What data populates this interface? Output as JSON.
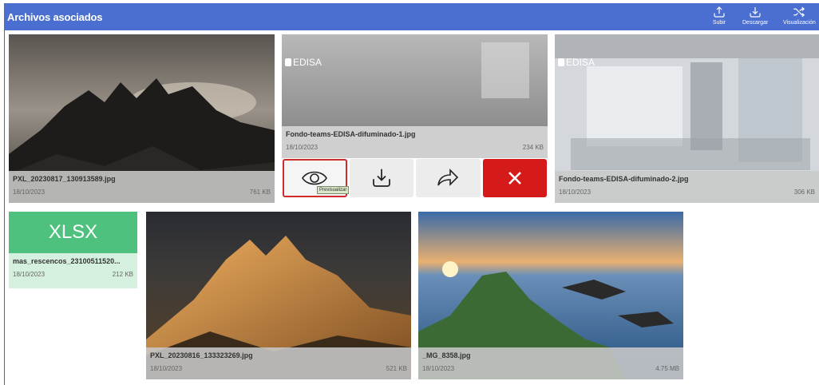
{
  "header": {
    "title": "Archivos asociados",
    "buttons": [
      {
        "label": "Subir",
        "icon": "upload-icon"
      },
      {
        "label": "Descargar",
        "icon": "download-icon"
      },
      {
        "label": "Visualización",
        "icon": "shuffle-icon"
      }
    ]
  },
  "files": [
    {
      "name": "PXL_20230817_130913589.jpg",
      "date": "18/10/2023",
      "size": "761 KB"
    },
    {
      "name": "Fondo-teams-EDISA-difuminado-1.jpg",
      "date": "18/10/2023",
      "size": "234 KB",
      "logo": "EDISA"
    },
    {
      "name": "Fondo-teams-EDISA-difuminado-2.jpg",
      "date": "18/10/2023",
      "size": "306 KB",
      "logo": "EDISA"
    },
    {
      "name": "mas_rescencos_23100511520...",
      "date": "18/10/2023",
      "size": "212 KB",
      "type_label": "XLSX"
    },
    {
      "name": "PXL_20230816_133323269.jpg",
      "date": "18/10/2023",
      "size": "521 KB"
    },
    {
      "name": "_MG_8358.jpg",
      "date": "18/10/2023",
      "size": "4.75 MB"
    }
  ],
  "actions": {
    "tooltip": "Previsualizar",
    "icons": [
      "eye-icon",
      "download-icon",
      "share-arrow-icon",
      "close-icon"
    ]
  },
  "colors": {
    "header_bg": "#4a6fd0",
    "delete": "#d51a1a",
    "xlsx": "#4fc17e",
    "focus_border": "#d02c2c"
  }
}
